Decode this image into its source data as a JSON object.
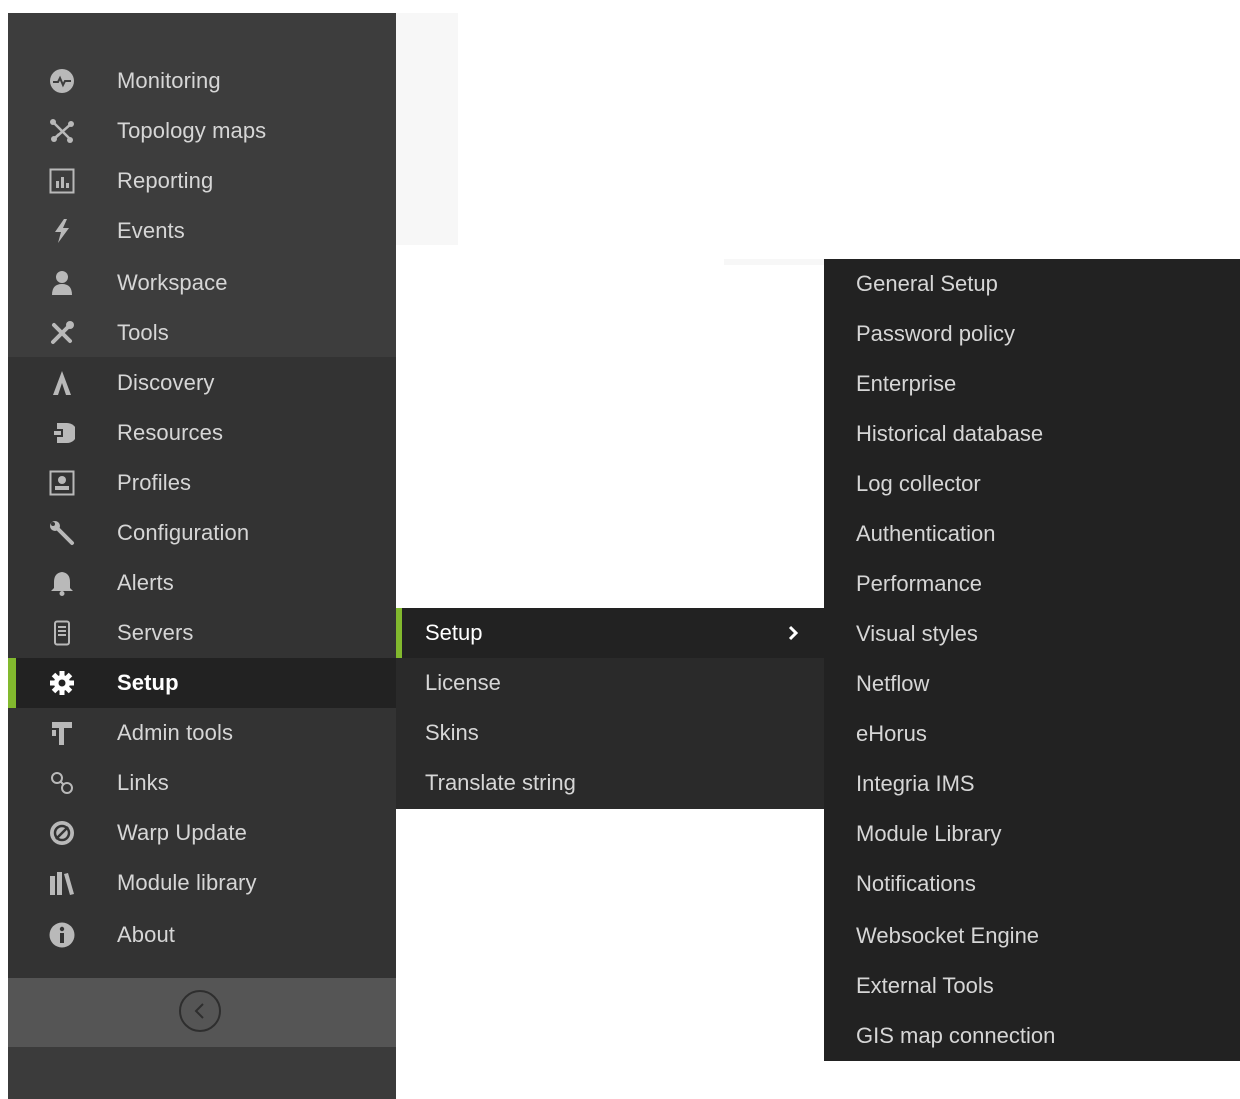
{
  "sidebar": {
    "items": [
      {
        "label": "Monitoring",
        "icon": "heartbeat-icon"
      },
      {
        "label": "Topology maps",
        "icon": "topology-icon"
      },
      {
        "label": "Reporting",
        "icon": "report-chart-icon"
      },
      {
        "label": "Events",
        "icon": "lightning-icon"
      },
      {
        "label": "Workspace",
        "icon": "user-icon"
      },
      {
        "label": "Tools",
        "icon": "tools-icon"
      },
      {
        "label": "Discovery",
        "icon": "discovery-icon"
      },
      {
        "label": "Resources",
        "icon": "resources-icon"
      },
      {
        "label": "Profiles",
        "icon": "profile-card-icon"
      },
      {
        "label": "Configuration",
        "icon": "wrench-icon"
      },
      {
        "label": "Alerts",
        "icon": "bell-icon"
      },
      {
        "label": "Servers",
        "icon": "server-icon"
      },
      {
        "label": "Setup",
        "icon": "gear-icon",
        "active": true
      },
      {
        "label": "Admin tools",
        "icon": "hammer-icon"
      },
      {
        "label": "Links",
        "icon": "link-icon"
      },
      {
        "label": "Warp Update",
        "icon": "warp-update-icon"
      },
      {
        "label": "Module library",
        "icon": "library-icon"
      },
      {
        "label": "About",
        "icon": "info-icon"
      }
    ],
    "collapse_icon": "chevron-left-circle-icon"
  },
  "submenu": {
    "items": [
      {
        "label": "Setup",
        "active": true,
        "icon": "chevron-right-icon"
      },
      {
        "label": "License"
      },
      {
        "label": "Skins"
      },
      {
        "label": "Translate string"
      }
    ]
  },
  "submenu2": {
    "items": [
      {
        "label": "General Setup"
      },
      {
        "label": "Password policy"
      },
      {
        "label": "Enterprise"
      },
      {
        "label": "Historical database"
      },
      {
        "label": "Log collector"
      },
      {
        "label": "Authentication"
      },
      {
        "label": "Performance"
      },
      {
        "label": "Visual styles"
      },
      {
        "label": "Netflow"
      },
      {
        "label": "eHorus"
      },
      {
        "label": "Integria IMS"
      },
      {
        "label": "Module Library"
      },
      {
        "label": "Notifications"
      },
      {
        "label": "Websocket Engine"
      },
      {
        "label": "External Tools"
      },
      {
        "label": "GIS map connection"
      }
    ]
  },
  "colors": {
    "accent": "#82b92e",
    "sidebar_bg": "#3d3d3d",
    "submenu_bg": "#2a2a2a",
    "submenu2_bg": "#222222"
  }
}
